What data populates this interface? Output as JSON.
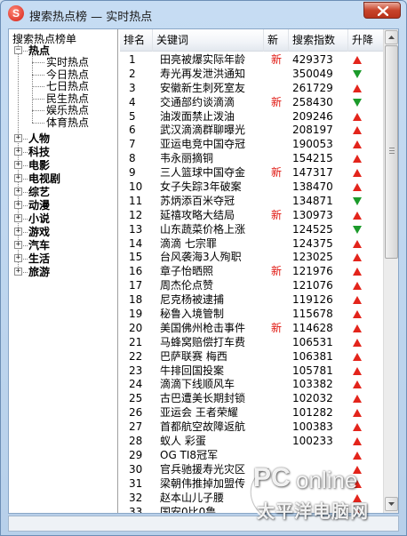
{
  "window": {
    "title": "搜索热点榜 — 实时热点",
    "app_icon_letter": "S"
  },
  "tree": {
    "root_label": "搜索热点榜单",
    "categories": [
      {
        "label": "热点",
        "expander": "-",
        "children": [
          "实时热点",
          "今日热点",
          "七日热点",
          "民生热点",
          "娱乐热点",
          "体育热点"
        ]
      },
      {
        "label": "人物",
        "expander": "+"
      },
      {
        "label": "科技",
        "expander": "+"
      },
      {
        "label": "电影",
        "expander": "+"
      },
      {
        "label": "电视剧",
        "expander": "+"
      },
      {
        "label": "综艺",
        "expander": "+"
      },
      {
        "label": "动漫",
        "expander": "+"
      },
      {
        "label": "小说",
        "expander": "+"
      },
      {
        "label": "游戏",
        "expander": "+"
      },
      {
        "label": "汽车",
        "expander": "+"
      },
      {
        "label": "生活",
        "expander": "+"
      },
      {
        "label": "旅游",
        "expander": "+"
      }
    ]
  },
  "list": {
    "headers": {
      "rank": "排名",
      "keyword": "关键词",
      "new": "新",
      "index": "搜索指数",
      "trend": "升降"
    },
    "new_label": "新",
    "rows": [
      {
        "rank": "1",
        "keyword": "田亮被爆实际年龄",
        "new": true,
        "index": "429373",
        "trend": "up"
      },
      {
        "rank": "2",
        "keyword": "寿光再发泄洪通知",
        "new": false,
        "index": "350049",
        "trend": "down"
      },
      {
        "rank": "3",
        "keyword": "安徽新生刺死室友",
        "new": false,
        "index": "261729",
        "trend": "up"
      },
      {
        "rank": "4",
        "keyword": "交通部约谈滴滴",
        "new": true,
        "index": "258430",
        "trend": "down"
      },
      {
        "rank": "5",
        "keyword": "油泼面禁止泼油",
        "new": false,
        "index": "209246",
        "trend": "up"
      },
      {
        "rank": "6",
        "keyword": "武汉滴滴群聊曝光",
        "new": false,
        "index": "208197",
        "trend": "up"
      },
      {
        "rank": "7",
        "keyword": "亚运电竞中国夺冠",
        "new": false,
        "index": "190053",
        "trend": "up"
      },
      {
        "rank": "8",
        "keyword": "韦永丽摘铜",
        "new": false,
        "index": "154215",
        "trend": "up"
      },
      {
        "rank": "9",
        "keyword": "三人篮球中国夺金",
        "new": true,
        "index": "147317",
        "trend": "up"
      },
      {
        "rank": "10",
        "keyword": "女子失踪3年破案",
        "new": false,
        "index": "138470",
        "trend": "up"
      },
      {
        "rank": "11",
        "keyword": "苏炳添百米夺冠",
        "new": false,
        "index": "134871",
        "trend": "down"
      },
      {
        "rank": "12",
        "keyword": "延禧攻略大结局",
        "new": true,
        "index": "130973",
        "trend": "up"
      },
      {
        "rank": "13",
        "keyword": "山东蔬菜价格上涨",
        "new": false,
        "index": "124525",
        "trend": "down"
      },
      {
        "rank": "14",
        "keyword": "滴滴 七宗罪",
        "new": false,
        "index": "124375",
        "trend": "up"
      },
      {
        "rank": "15",
        "keyword": "台风袭海3人殉职",
        "new": false,
        "index": "123025",
        "trend": "up"
      },
      {
        "rank": "16",
        "keyword": "章子怡晒照",
        "new": true,
        "index": "121976",
        "trend": "up"
      },
      {
        "rank": "17",
        "keyword": "周杰伦点赞",
        "new": false,
        "index": "121076",
        "trend": "up"
      },
      {
        "rank": "18",
        "keyword": "尼克杨被逮捕",
        "new": false,
        "index": "119126",
        "trend": "up"
      },
      {
        "rank": "19",
        "keyword": "秘鲁入境管制",
        "new": false,
        "index": "115678",
        "trend": "up"
      },
      {
        "rank": "20",
        "keyword": "美国佛州枪击事件",
        "new": true,
        "index": "114628",
        "trend": "up"
      },
      {
        "rank": "21",
        "keyword": "马蜂窝赔偿打车费",
        "new": false,
        "index": "106531",
        "trend": "up"
      },
      {
        "rank": "22",
        "keyword": "巴萨联赛 梅西",
        "new": false,
        "index": "106381",
        "trend": "up"
      },
      {
        "rank": "23",
        "keyword": "牛排回国投案",
        "new": false,
        "index": "105781",
        "trend": "up"
      },
      {
        "rank": "24",
        "keyword": "滴滴下线顺风车",
        "new": false,
        "index": "103382",
        "trend": "up"
      },
      {
        "rank": "25",
        "keyword": "古巴遭美长期封锁",
        "new": false,
        "index": "102032",
        "trend": "up"
      },
      {
        "rank": "26",
        "keyword": "亚运会 王者荣耀",
        "new": false,
        "index": "101282",
        "trend": "up"
      },
      {
        "rank": "27",
        "keyword": "首都航空故障返航",
        "new": false,
        "index": "100383",
        "trend": "up"
      },
      {
        "rank": "28",
        "keyword": "蚁人 彩蛋",
        "new": false,
        "index": "100233",
        "trend": "up"
      },
      {
        "rank": "29",
        "keyword": "OG TI8冠军",
        "new": false,
        "index": "",
        "trend": "up"
      },
      {
        "rank": "30",
        "keyword": "官兵驰援寿光灾区",
        "new": false,
        "index": "",
        "trend": "up"
      },
      {
        "rank": "31",
        "keyword": "梁朝伟推掉加盟传",
        "new": false,
        "index": "",
        "trend": "up"
      },
      {
        "rank": "32",
        "keyword": "赵本山儿子腰",
        "new": false,
        "index": "",
        "trend": "up"
      },
      {
        "rank": "33",
        "keyword": "国安0比0鲁",
        "new": false,
        "index": "",
        "trend": "up"
      }
    ]
  },
  "watermark": {
    "brand_pc": "PC",
    "brand_online": "online",
    "brand_cn": "太平洋电脑网"
  },
  "colors": {
    "up": "#e3241b",
    "down": "#1b9a2a",
    "new": "#e0150e"
  }
}
